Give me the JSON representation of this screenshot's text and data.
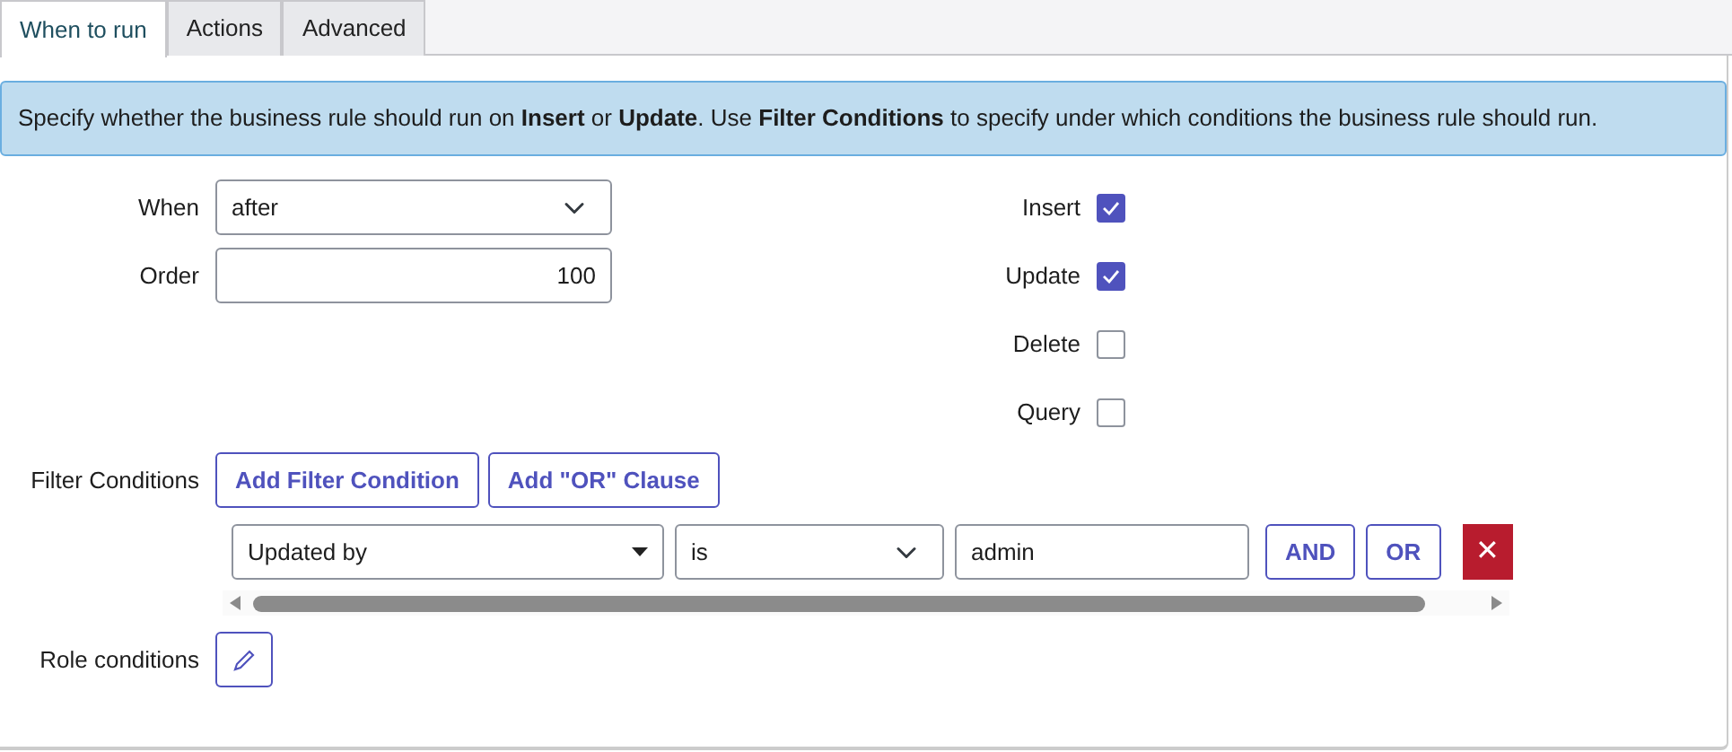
{
  "tabs": [
    {
      "label": "When to run",
      "selected": true
    },
    {
      "label": "Actions",
      "selected": false
    },
    {
      "label": "Advanced",
      "selected": false
    }
  ],
  "info_message": "Specify whether the business rule should run on **Insert** or **Update**. Use **Filter Conditions** to specify under which conditions the business rule should run.",
  "fields": [
    {
      "label": "When",
      "kind": "select",
      "value": "after"
    },
    {
      "label": "Order",
      "kind": "number",
      "value": "100"
    }
  ],
  "operations": [
    {
      "label": "Insert",
      "checked": true
    },
    {
      "label": "Update",
      "checked": true
    },
    {
      "label": "Delete",
      "checked": false
    },
    {
      "label": "Query",
      "checked": false
    }
  ],
  "filter_conditions": {
    "label": "Filter Conditions",
    "buttons": [
      "Add Filter Condition",
      "Add \"OR\" Clause"
    ],
    "condition": {
      "field": "Updated by",
      "operator": "is",
      "value": "admin",
      "buttons": [
        "AND",
        "OR"
      ],
      "delete_icon": "✕"
    }
  },
  "role_conditions": {
    "label": "Role conditions"
  }
}
